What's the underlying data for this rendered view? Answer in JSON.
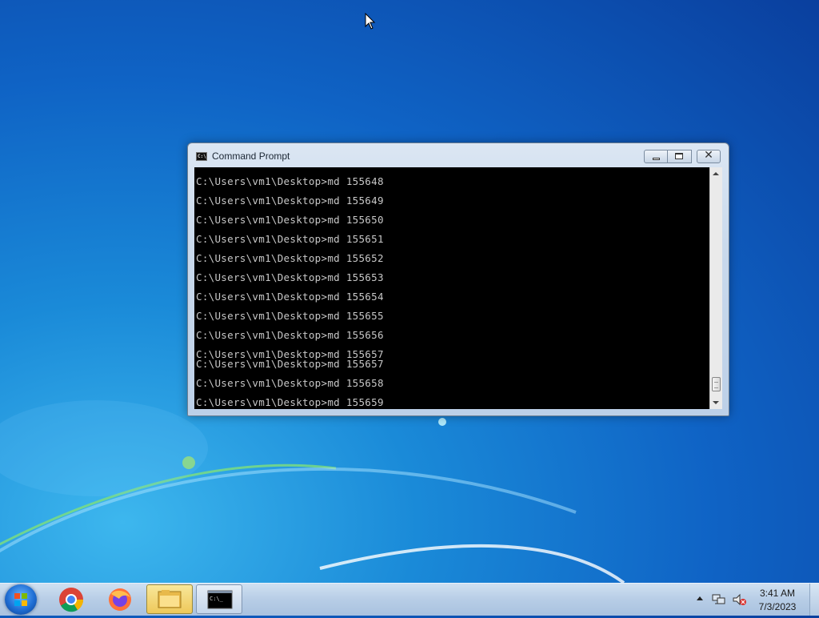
{
  "window": {
    "title": "Command Prompt",
    "icon": "cmd-icon",
    "controls": [
      "minimize-icon",
      "maximize-icon",
      "close-icon"
    ]
  },
  "console": {
    "lines": [
      "C:\\Users\\vm1\\Desktop>md 155648",
      "C:\\Users\\vm1\\Desktop>md 155649",
      "C:\\Users\\vm1\\Desktop>md 155650",
      "C:\\Users\\vm1\\Desktop>md 155651",
      "C:\\Users\\vm1\\Desktop>md 155652",
      "C:\\Users\\vm1\\Desktop>md 155653",
      "C:\\Users\\vm1\\Desktop>md 155654",
      "C:\\Users\\vm1\\Desktop>md 155655",
      "C:\\Users\\vm1\\Desktop>md 155656",
      "C:\\Users\\vm1\\Desktop>md 155657",
      "C:\\Users\\vm1\\Desktop>md 155657",
      "C:\\Users\\vm1\\Desktop>md 155658",
      "C:\\Users\\vm1\\Desktop>md 155659"
    ],
    "background": "#000000",
    "text_color": "#c8c8c8"
  },
  "taskbar": {
    "items": [
      "windows-start-icon",
      "chrome-icon",
      "firefox-icon",
      "file-explorer-icon",
      "cmd-icon"
    ],
    "tray": {
      "icons": [
        "show-hidden-icons-arrow",
        "network-icon",
        "volume-muted-icon"
      ],
      "time": "3:41 AM",
      "date": "7/3/2023"
    }
  }
}
